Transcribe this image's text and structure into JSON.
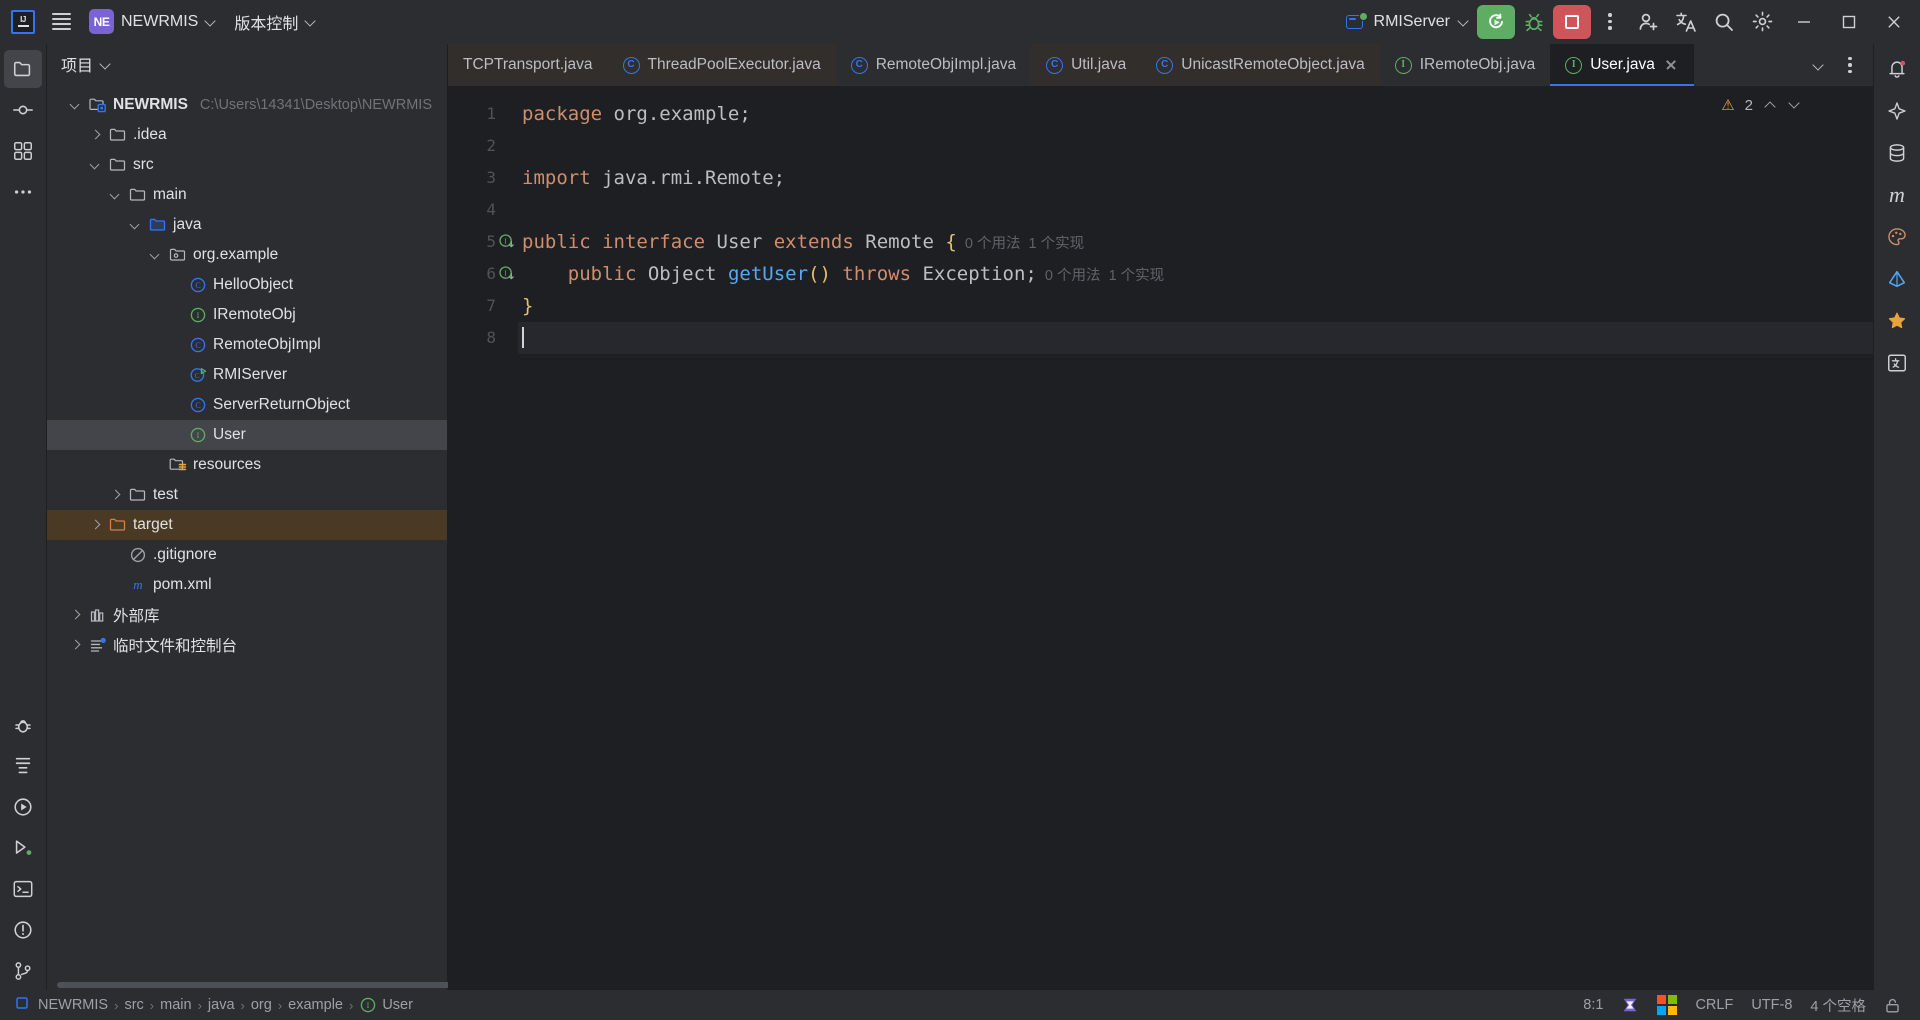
{
  "titlebar": {
    "ij_logo": "IJ",
    "menu_icon": "hamburger-menu-icon",
    "project_badge": "NE",
    "project_name": "NEWRMIS",
    "vcs_label": "版本控制",
    "run_config_name": "RMIServer",
    "run_icon": "rerun-icon",
    "debug_icon": "debug-bug-icon",
    "stop_icon": "stop-icon",
    "more_icon": "more-vertical-icon",
    "share_icon": "add-user-icon",
    "translate_icon": "translate-icon",
    "search_icon": "search-icon",
    "settings_icon": "settings-gear-icon",
    "minimize_icon": "minimize-icon",
    "maximize_icon": "maximize-icon",
    "close_icon": "close-icon"
  },
  "left_rail": [
    {
      "name": "project-tool-window",
      "icon": "folder-icon",
      "active": true
    },
    {
      "name": "commit-tool-window",
      "icon": "commit-icon",
      "active": false
    },
    {
      "name": "structure-tool-window",
      "icon": "structure-grid-icon",
      "active": false
    },
    {
      "name": "more-tool-windows",
      "icon": "ellipsis-icon",
      "active": false
    },
    {
      "name": "debug-tool-window",
      "icon": "debug-icon",
      "active": false
    },
    {
      "name": "todo-tool-window",
      "icon": "todo-icon",
      "active": false
    },
    {
      "name": "run-tool-window",
      "icon": "run-play-icon",
      "active": false
    },
    {
      "name": "services-tool-window",
      "icon": "services-run-icon",
      "active": false
    },
    {
      "name": "terminal-tool-window",
      "icon": "terminal-icon",
      "active": false
    },
    {
      "name": "problems-tool-window",
      "icon": "problems-icon",
      "active": false
    },
    {
      "name": "git-tool-window",
      "icon": "git-branch-icon",
      "active": false
    }
  ],
  "right_rail": [
    {
      "name": "notifications",
      "icon": "bell-icon"
    },
    {
      "name": "ai-assistant",
      "icon": "ai-icon"
    },
    {
      "name": "database",
      "icon": "database-icon"
    },
    {
      "name": "maven",
      "icon": "maven-m-icon"
    },
    {
      "name": "ui-designer",
      "icon": "palette-icon"
    },
    {
      "name": "gradle",
      "icon": "gradle-elephant-icon"
    },
    {
      "name": "bookmarks",
      "icon": "bookmark-star-icon"
    },
    {
      "name": "translation",
      "icon": "translation-panel-icon"
    }
  ],
  "project_panel": {
    "title": "项目",
    "chevron_icon": "chevron-down-icon",
    "tree": [
      {
        "label": "NEWRMIS",
        "path": "C:\\Users\\14341\\Desktop\\NEWRMIS",
        "depth": 0,
        "arrow": "open",
        "icon": "module-folder-icon",
        "bold": true,
        "state": ""
      },
      {
        "label": ".idea",
        "path": "",
        "depth": 1,
        "arrow": "closed",
        "icon": "folder-icon",
        "bold": false,
        "state": ""
      },
      {
        "label": "src",
        "path": "",
        "depth": 1,
        "arrow": "open",
        "icon": "folder-icon",
        "bold": false,
        "state": ""
      },
      {
        "label": "main",
        "path": "",
        "depth": 2,
        "arrow": "open",
        "icon": "folder-icon",
        "bold": false,
        "state": ""
      },
      {
        "label": "java",
        "path": "",
        "depth": 3,
        "arrow": "open",
        "icon": "source-root-folder-icon",
        "bold": false,
        "state": ""
      },
      {
        "label": "org.example",
        "path": "",
        "depth": 4,
        "arrow": "open",
        "icon": "package-icon",
        "bold": false,
        "state": ""
      },
      {
        "label": "HelloObject",
        "path": "",
        "depth": 5,
        "arrow": "none",
        "icon": "java-class-icon",
        "bold": false,
        "state": ""
      },
      {
        "label": "IRemoteObj",
        "path": "",
        "depth": 5,
        "arrow": "none",
        "icon": "java-interface-icon",
        "bold": false,
        "state": ""
      },
      {
        "label": "RemoteObjImpl",
        "path": "",
        "depth": 5,
        "arrow": "none",
        "icon": "java-class-icon",
        "bold": false,
        "state": ""
      },
      {
        "label": "RMIServer",
        "path": "",
        "depth": 5,
        "arrow": "none",
        "icon": "java-runnable-class-icon",
        "bold": false,
        "state": ""
      },
      {
        "label": "ServerReturnObject",
        "path": "",
        "depth": 5,
        "arrow": "none",
        "icon": "java-class-icon",
        "bold": false,
        "state": ""
      },
      {
        "label": "User",
        "path": "",
        "depth": 5,
        "arrow": "none",
        "icon": "java-interface-icon",
        "bold": false,
        "state": "selected"
      },
      {
        "label": "resources",
        "path": "",
        "depth": 4,
        "arrow": "none",
        "icon": "resources-folder-icon",
        "bold": false,
        "state": ""
      },
      {
        "label": "test",
        "path": "",
        "depth": 2,
        "arrow": "closed",
        "icon": "folder-icon",
        "bold": false,
        "state": ""
      },
      {
        "label": "target",
        "path": "",
        "depth": 1,
        "arrow": "closed",
        "icon": "excluded-folder-icon",
        "bold": false,
        "state": "highlight"
      },
      {
        "label": ".gitignore",
        "path": "",
        "depth": 2,
        "arrow": "none",
        "icon": "gitignore-icon",
        "bold": false,
        "state": ""
      },
      {
        "label": "pom.xml",
        "path": "",
        "depth": 2,
        "arrow": "none",
        "icon": "maven-m-icon",
        "bold": false,
        "state": ""
      },
      {
        "label": "外部库",
        "path": "",
        "depth": 0,
        "arrow": "closed",
        "icon": "external-libraries-icon",
        "bold": false,
        "state": ""
      },
      {
        "label": "临时文件和控制台",
        "path": "",
        "depth": 0,
        "arrow": "closed",
        "icon": "scratches-icon",
        "bold": false,
        "state": ""
      }
    ]
  },
  "editor": {
    "tabs": [
      {
        "label": "TCPTransport.java",
        "icon": "java-class-icon",
        "state": "modified"
      },
      {
        "label": "ThreadPoolExecutor.java",
        "icon": "java-class-icon",
        "state": "modified"
      },
      {
        "label": "RemoteObjImpl.java",
        "icon": "java-class-icon",
        "state": ""
      },
      {
        "label": "Util.java",
        "icon": "java-class-icon",
        "state": "modified"
      },
      {
        "label": "UnicastRemoteObject.java",
        "icon": "java-class-icon",
        "state": "modified"
      },
      {
        "label": "IRemoteObj.java",
        "icon": "java-interface-icon",
        "state": ""
      },
      {
        "label": "User.java",
        "icon": "java-interface-icon",
        "state": "active"
      }
    ],
    "close_icon": "close-icon",
    "tab_list_icon": "chevron-down-icon",
    "tab_options_icon": "more-vertical-icon",
    "inspection": {
      "warning_icon": "warning-triangle-icon",
      "warning_count": "2",
      "prev_icon": "chevron-up-icon",
      "next_icon": "chevron-down-icon"
    },
    "line_numbers": [
      "1",
      "2",
      "3",
      "4",
      "5",
      "6",
      "7",
      "8"
    ],
    "gutter_marks": [
      {
        "line": 5,
        "icon": "implemented-interface-marker"
      },
      {
        "line": 6,
        "icon": "implemented-method-marker"
      }
    ],
    "lines": [
      {
        "n": 1,
        "tokens": [
          {
            "t": "package",
            "c": "kw"
          },
          {
            "t": " org.example;",
            "c": "pl"
          }
        ]
      },
      {
        "n": 2,
        "tokens": []
      },
      {
        "n": 3,
        "tokens": [
          {
            "t": "import",
            "c": "kw"
          },
          {
            "t": " java.rmi.Remote;",
            "c": "pl"
          }
        ]
      },
      {
        "n": 4,
        "tokens": []
      },
      {
        "n": 5,
        "tokens": [
          {
            "t": "public",
            "c": "kw"
          },
          {
            "t": " ",
            "c": "pl"
          },
          {
            "t": "interface",
            "c": "kw"
          },
          {
            "t": " ",
            "c": "pl"
          },
          {
            "t": "User",
            "c": "cls"
          },
          {
            "t": " ",
            "c": "pl"
          },
          {
            "t": "extends",
            "c": "kw"
          },
          {
            "t": " ",
            "c": "pl"
          },
          {
            "t": "Remote",
            "c": "cls"
          },
          {
            "t": " ",
            "c": "pl"
          },
          {
            "t": "{",
            "c": "br"
          },
          {
            "t": "  0 个用法  1 个实现",
            "c": "hint"
          }
        ]
      },
      {
        "n": 6,
        "tokens": [
          {
            "t": "    ",
            "c": "pl"
          },
          {
            "t": "public",
            "c": "kw"
          },
          {
            "t": " ",
            "c": "pl"
          },
          {
            "t": "Object",
            "c": "cls"
          },
          {
            "t": " ",
            "c": "pl"
          },
          {
            "t": "getUser",
            "c": "mth"
          },
          {
            "t": "()",
            "c": "br"
          },
          {
            "t": " ",
            "c": "pl"
          },
          {
            "t": "throws",
            "c": "kw"
          },
          {
            "t": " ",
            "c": "pl"
          },
          {
            "t": "Exception",
            "c": "cls"
          },
          {
            "t": ";",
            "c": "pl"
          },
          {
            "t": "  0 个用法  1 个实现",
            "c": "hint"
          }
        ]
      },
      {
        "n": 7,
        "tokens": [
          {
            "t": "}",
            "c": "br"
          }
        ]
      },
      {
        "n": 8,
        "tokens": [],
        "cursor": true
      }
    ]
  },
  "statusbar": {
    "breadcrumb": [
      {
        "label": "NEWRMIS",
        "icon": "project-icon"
      },
      {
        "label": "src",
        "icon": ""
      },
      {
        "label": "main",
        "icon": ""
      },
      {
        "label": "java",
        "icon": ""
      },
      {
        "label": "org",
        "icon": ""
      },
      {
        "label": "example",
        "icon": ""
      },
      {
        "label": "User",
        "icon": "java-interface-icon"
      }
    ],
    "caret_position": "8:1",
    "ide_eval_icon": "bookmark-purple-icon",
    "ms_icon": "microsoft-logo-icon",
    "line_separator": "CRLF",
    "encoding": "UTF-8",
    "indent": "4 个空格",
    "lock_icon": "unlocked-icon"
  },
  "colors": {
    "accent_blue": "#3574f0",
    "green": "#5fad65",
    "red": "#d0555a",
    "purple": "#7a63d5",
    "orange": "#cf8e6d",
    "titlebar_bg": "#2b2d30",
    "editor_bg": "#1e1f22",
    "selection_bg": "#43454a",
    "excluded_bg": "#4a3a23"
  }
}
